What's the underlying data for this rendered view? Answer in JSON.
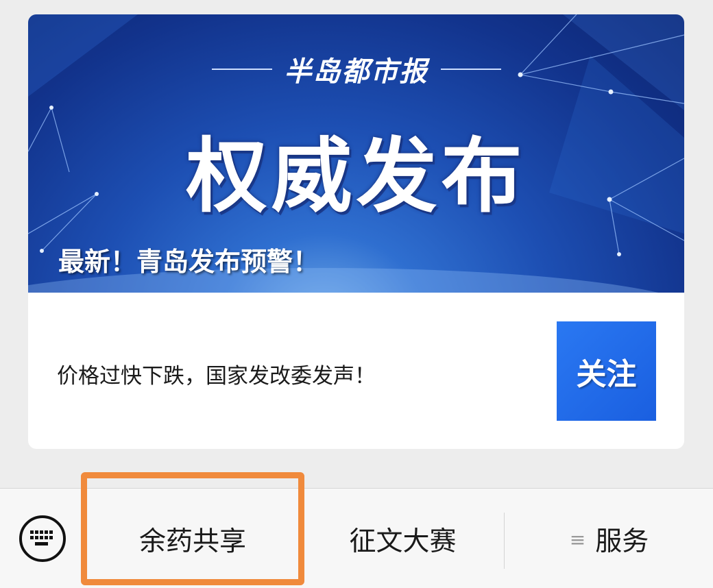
{
  "banner": {
    "brand": "半岛都市报",
    "title": "权威发布",
    "caption": "最新！青岛发布预警！"
  },
  "article": {
    "text": "价格过快下跌，国家发改委发声！",
    "follow_label": "关注"
  },
  "menu": {
    "items": [
      {
        "label": "余药共享"
      },
      {
        "label": "征文大赛"
      },
      {
        "label": "服务"
      }
    ],
    "list_icon": "≡"
  },
  "colors": {
    "follow_button": "#1a66ea",
    "highlight": "#f08a3c",
    "banner_blue": "#1d4fb3"
  },
  "icons": [
    "keyboard-icon",
    "list-icon"
  ]
}
